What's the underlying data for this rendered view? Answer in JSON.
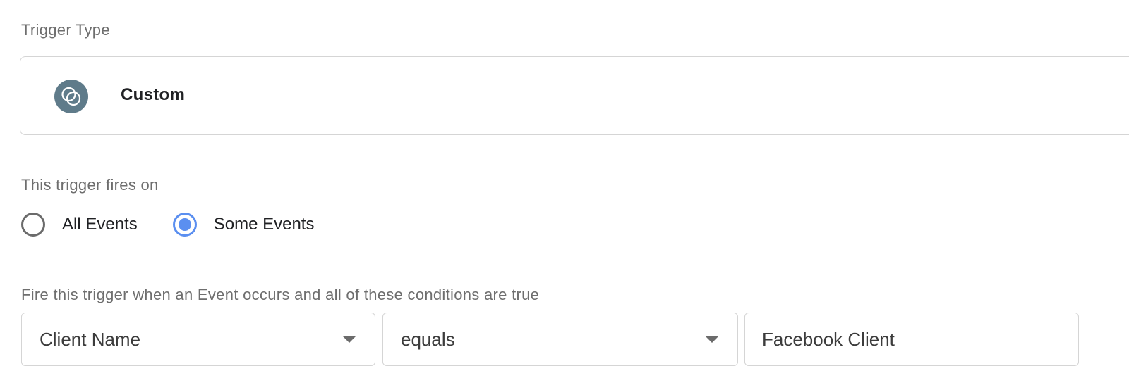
{
  "trigger_type": {
    "label": "Trigger Type",
    "selected": "Custom",
    "icon": "custom-event-icon",
    "icon_color": "#5f7b8a"
  },
  "fires_on": {
    "label": "This trigger fires on",
    "options": [
      {
        "label": "All Events",
        "checked": false
      },
      {
        "label": "Some Events",
        "checked": true
      }
    ],
    "accent_color": "#5b8ff0"
  },
  "conditions": {
    "label": "Fire this trigger when an Event occurs and all of these conditions are true",
    "rows": [
      {
        "variable": "Client Name",
        "operator": "equals",
        "value": "Facebook Client"
      }
    ]
  }
}
